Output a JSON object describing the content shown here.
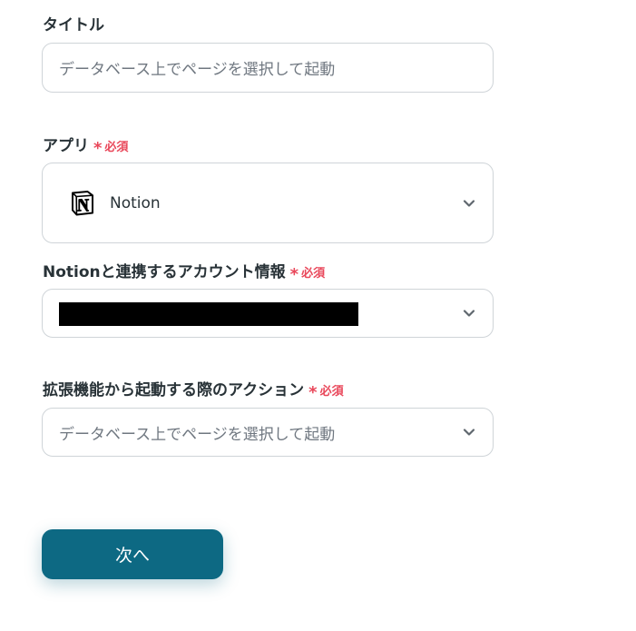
{
  "form": {
    "title_field": {
      "label": "タイトル",
      "value": "データベース上でページを選択して起動"
    },
    "app_field": {
      "label": "アプリ",
      "required_mark": "*",
      "required_text": "必須",
      "value": "Notion",
      "icon": "notion-icon"
    },
    "account_field": {
      "label": "Notionと連携するアカウント情報",
      "required_mark": "*",
      "required_text": "必須",
      "value_redacted": true
    },
    "action_field": {
      "label": "拡張機能から起動する際のアクション",
      "required_mark": "*",
      "required_text": "必須",
      "value": "データベース上でページを選択して起動"
    }
  },
  "next_button": {
    "label": "次へ"
  },
  "colors": {
    "accent": "#0d6983",
    "required": "#e9475a",
    "border": "#cfd4d8",
    "text": "#283237"
  }
}
